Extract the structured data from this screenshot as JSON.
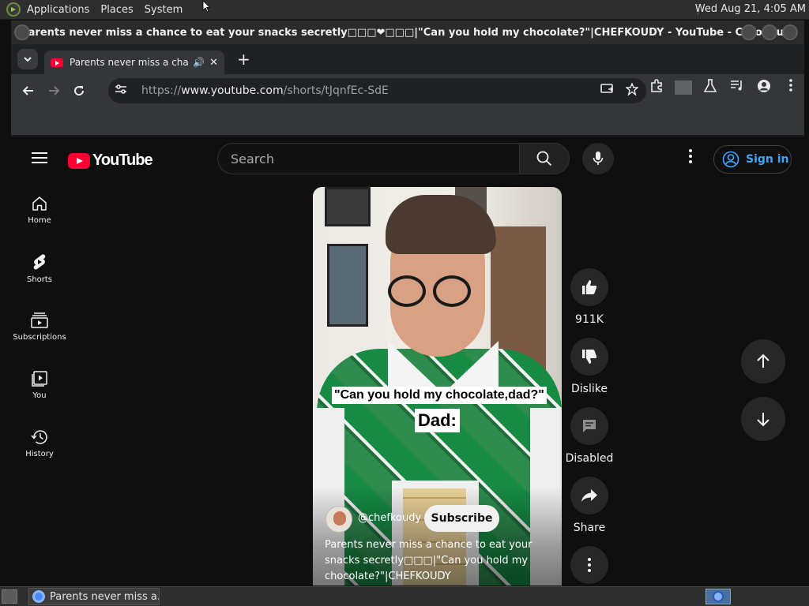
{
  "os": {
    "menus": [
      "Applications",
      "Places",
      "System"
    ],
    "clock": "Wed Aug 21,  4:05 AM",
    "taskbar_item": "Parents never miss a..."
  },
  "browser": {
    "window_title": "Parents never miss a chance to eat your snacks secretly□□□❤□□□|\"Can you hold my chocolate?\"|CHEFKOUDY - YouTube - Chromium",
    "tab_title": "Parents never miss a chan",
    "url_scheme": "https://",
    "url_host": "www.youtube.com",
    "url_path": "/shorts/tJqnfEc-SdE"
  },
  "youtube": {
    "logo_text": "YouTube",
    "search_placeholder": "Search",
    "sign_in_label": "Sign in",
    "guide": [
      {
        "label": "Home",
        "icon": "home-icon"
      },
      {
        "label": "Shorts",
        "icon": "shorts-icon"
      },
      {
        "label": "Subscriptions",
        "icon": "subscriptions-icon"
      },
      {
        "label": "You",
        "icon": "you-icon"
      },
      {
        "label": "History",
        "icon": "history-icon"
      }
    ],
    "short": {
      "caption_top": "\"Can you hold my chocolate,dad?\"",
      "caption_bottom": "Dad:",
      "channel": "@chefkoudy",
      "subscribe_label": "Subscribe",
      "description": "Parents never miss a chance to eat your snacks secretly□□□|\"Can you hold my chocolate?\"|CHEFKOUDY"
    },
    "actions": {
      "likes": "911K",
      "dislike_label": "Dislike",
      "comments_label": "Disabled",
      "share_label": "Share"
    }
  },
  "colors": {
    "brand_red": "#ff0033",
    "link_blue": "#3ea6ff",
    "page_bg": "#0f0f0f"
  }
}
